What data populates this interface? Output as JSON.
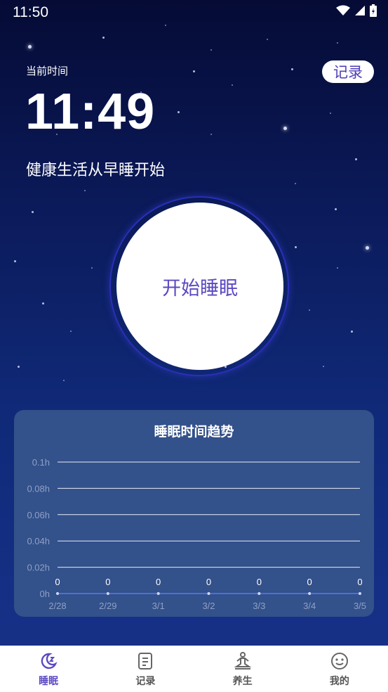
{
  "status_bar": {
    "time": "11:50"
  },
  "header": {
    "current_time_label": "当前时间",
    "current_time": "11:49",
    "slogan": "健康生活从早睡开始",
    "record_button": "记录"
  },
  "sleep_button": {
    "label": "开始睡眠"
  },
  "trend_card": {
    "title": "睡眠时间趋势"
  },
  "chart_data": {
    "type": "line",
    "title": "睡眠时间趋势",
    "categories": [
      "2/28",
      "2/29",
      "3/1",
      "3/2",
      "3/3",
      "3/4",
      "3/5"
    ],
    "values": [
      0,
      0,
      0,
      0,
      0,
      0,
      0
    ],
    "y_ticks": [
      "0h",
      "0.02h",
      "0.04h",
      "0.06h",
      "0.08h",
      "0.1h"
    ],
    "ylim": [
      0,
      0.1
    ],
    "grid": true
  },
  "tabs": [
    {
      "label": "睡眠",
      "icon": "moon-icon",
      "active": true
    },
    {
      "label": "记录",
      "icon": "record-list-icon",
      "active": false
    },
    {
      "label": "养生",
      "icon": "meditation-icon",
      "active": false
    },
    {
      "label": "我的",
      "icon": "smiley-icon",
      "active": false
    }
  ],
  "colors": {
    "accent": "#5b49c2",
    "card": "#33518a"
  }
}
